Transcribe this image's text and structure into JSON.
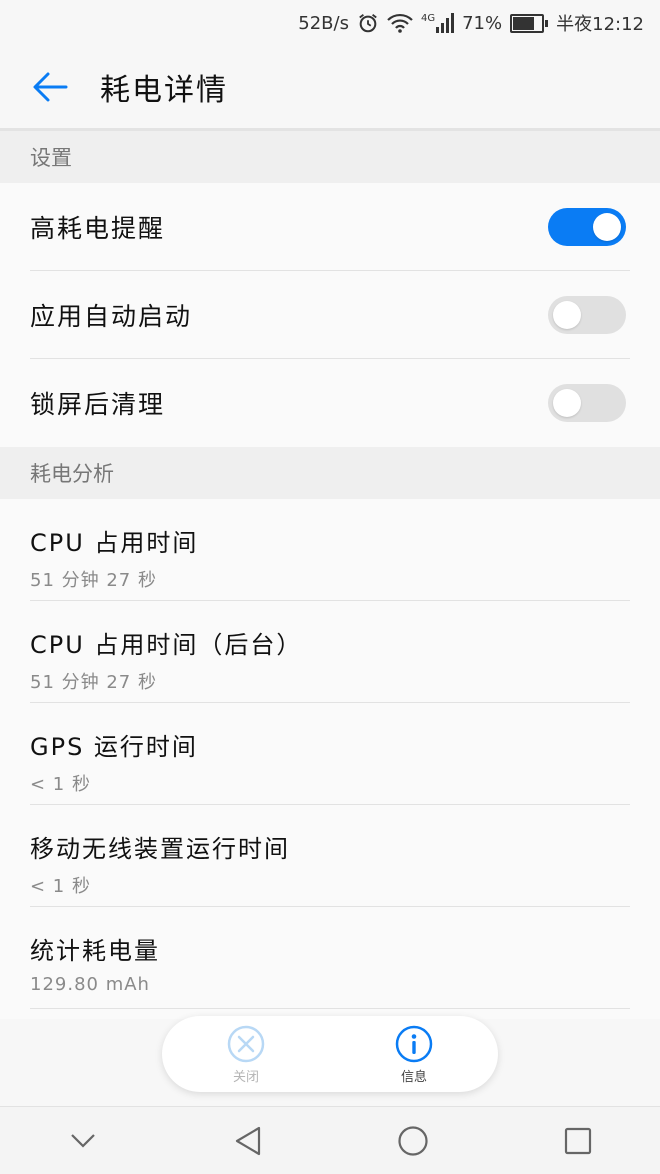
{
  "status_bar": {
    "net_speed": "52B/s",
    "network_type": "4G",
    "battery_percent": "71%",
    "battery_level": 0.71,
    "time": "半夜12:12",
    "icons": [
      "alarm-icon",
      "wifi-icon",
      "signal-icon",
      "battery-icon"
    ]
  },
  "app_bar": {
    "title": "耗电详情",
    "back_icon": "arrow-left-icon"
  },
  "settings": {
    "header": "设置",
    "items": [
      {
        "label": "高耗电提醒",
        "enabled": true
      },
      {
        "label": "应用自动启动",
        "enabled": false
      },
      {
        "label": "锁屏后清理",
        "enabled": false
      }
    ]
  },
  "analysis": {
    "header": "耗电分析",
    "items": [
      {
        "name": "CPU 占用时间",
        "value": "51 分钟 27 秒"
      },
      {
        "name": "CPU 占用时间（后台）",
        "value": "51 分钟 27 秒"
      },
      {
        "name": "GPS 运行时间",
        "value": "< 1 秒"
      },
      {
        "name": "移动无线装置运行时间",
        "value": "< 1 秒"
      },
      {
        "name": "统计耗电量",
        "value": "129.80 mAh"
      }
    ]
  },
  "floating_actions": {
    "close": {
      "label": "关闭",
      "icon": "close-circle-icon",
      "disabled": true
    },
    "info": {
      "label": "信息",
      "icon": "info-circle-icon",
      "disabled": false
    }
  },
  "colors": {
    "accent": "#0a7cf4",
    "toggle_off": "#e0e0e0",
    "disabled": "#b8d8f5"
  },
  "nav_bar": {
    "icons": [
      "chevron-down-icon",
      "back-triangle-icon",
      "home-circle-icon",
      "recents-square-icon"
    ]
  }
}
